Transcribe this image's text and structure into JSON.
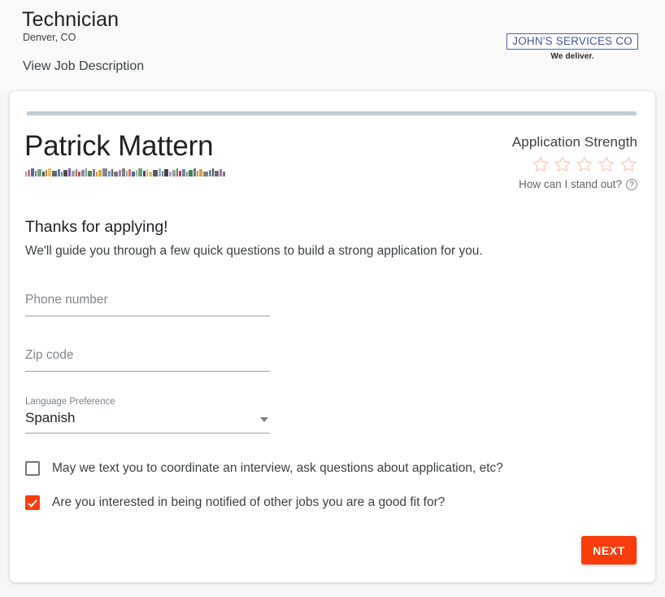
{
  "header": {
    "job_title": "Technician",
    "job_location": "Denver, CO",
    "view_job_link": "View Job Description",
    "logo": {
      "company_name": "JOHN'S SERVICES CO",
      "tagline": "We deliver.",
      "border_color": "#4a63ab",
      "text_color": "#4055a0"
    }
  },
  "card": {
    "progress": {
      "percent": 0,
      "track_color": "#c3ccd1",
      "fill_color": "#ff4612"
    },
    "applicant": {
      "name": "Patrick Mattern",
      "contact_line_redacted": true,
      "contact_line_note": "obscured contact text"
    },
    "strength": {
      "title": "Application Strength",
      "stars_total": 5,
      "stars_filled": 0,
      "star_color": "#fbd0bd",
      "help_text": "How can I stand out?",
      "help_icon": "question-circle-icon"
    },
    "intro": {
      "heading": "Thanks for applying!",
      "subtext": "We'll guide you through a few quick questions to build a strong application for you."
    },
    "form": {
      "phone": {
        "placeholder": "Phone number",
        "value": ""
      },
      "zip": {
        "placeholder": "Zip code",
        "value": ""
      },
      "language": {
        "label": "Language Preference",
        "value": "Spanish",
        "caret_icon": "chevron-down-icon"
      }
    },
    "checkboxes": [
      {
        "label": "May we text you to coordinate an interview, ask questions about application, etc?",
        "checked": false
      },
      {
        "label": "Are you interested in being notified of other jobs you are a good fit for?",
        "checked": true
      }
    ],
    "next_button": {
      "label": "NEXT",
      "color": "#fa3c0a"
    }
  }
}
